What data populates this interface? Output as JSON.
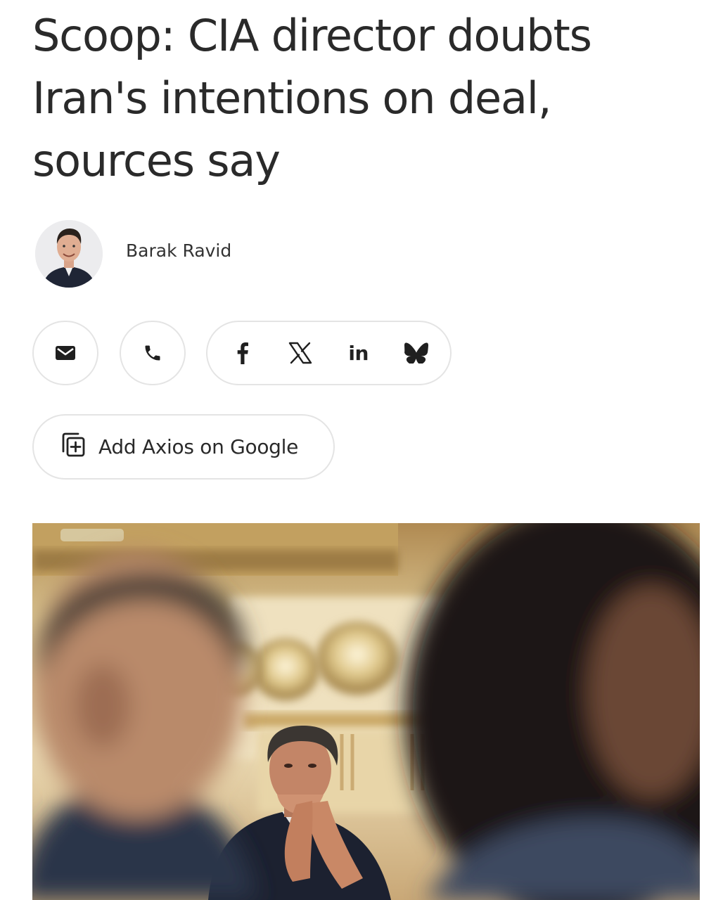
{
  "article": {
    "headline": "Scoop: CIA director doubts Iran's intentions on deal, sources say",
    "author": {
      "name": "Barak Ravid"
    }
  },
  "share": {
    "icons": [
      "email-icon",
      "phone-icon",
      "facebook-icon",
      "x-icon",
      "linkedin-icon",
      "bluesky-icon"
    ],
    "linkedin_label": "in"
  },
  "add_google": {
    "label": "Add Axios on Google",
    "icon": "add-source-icon"
  },
  "colors": {
    "text": "#2a2a2a",
    "border": "#e4e4e4",
    "background": "#ffffff"
  }
}
